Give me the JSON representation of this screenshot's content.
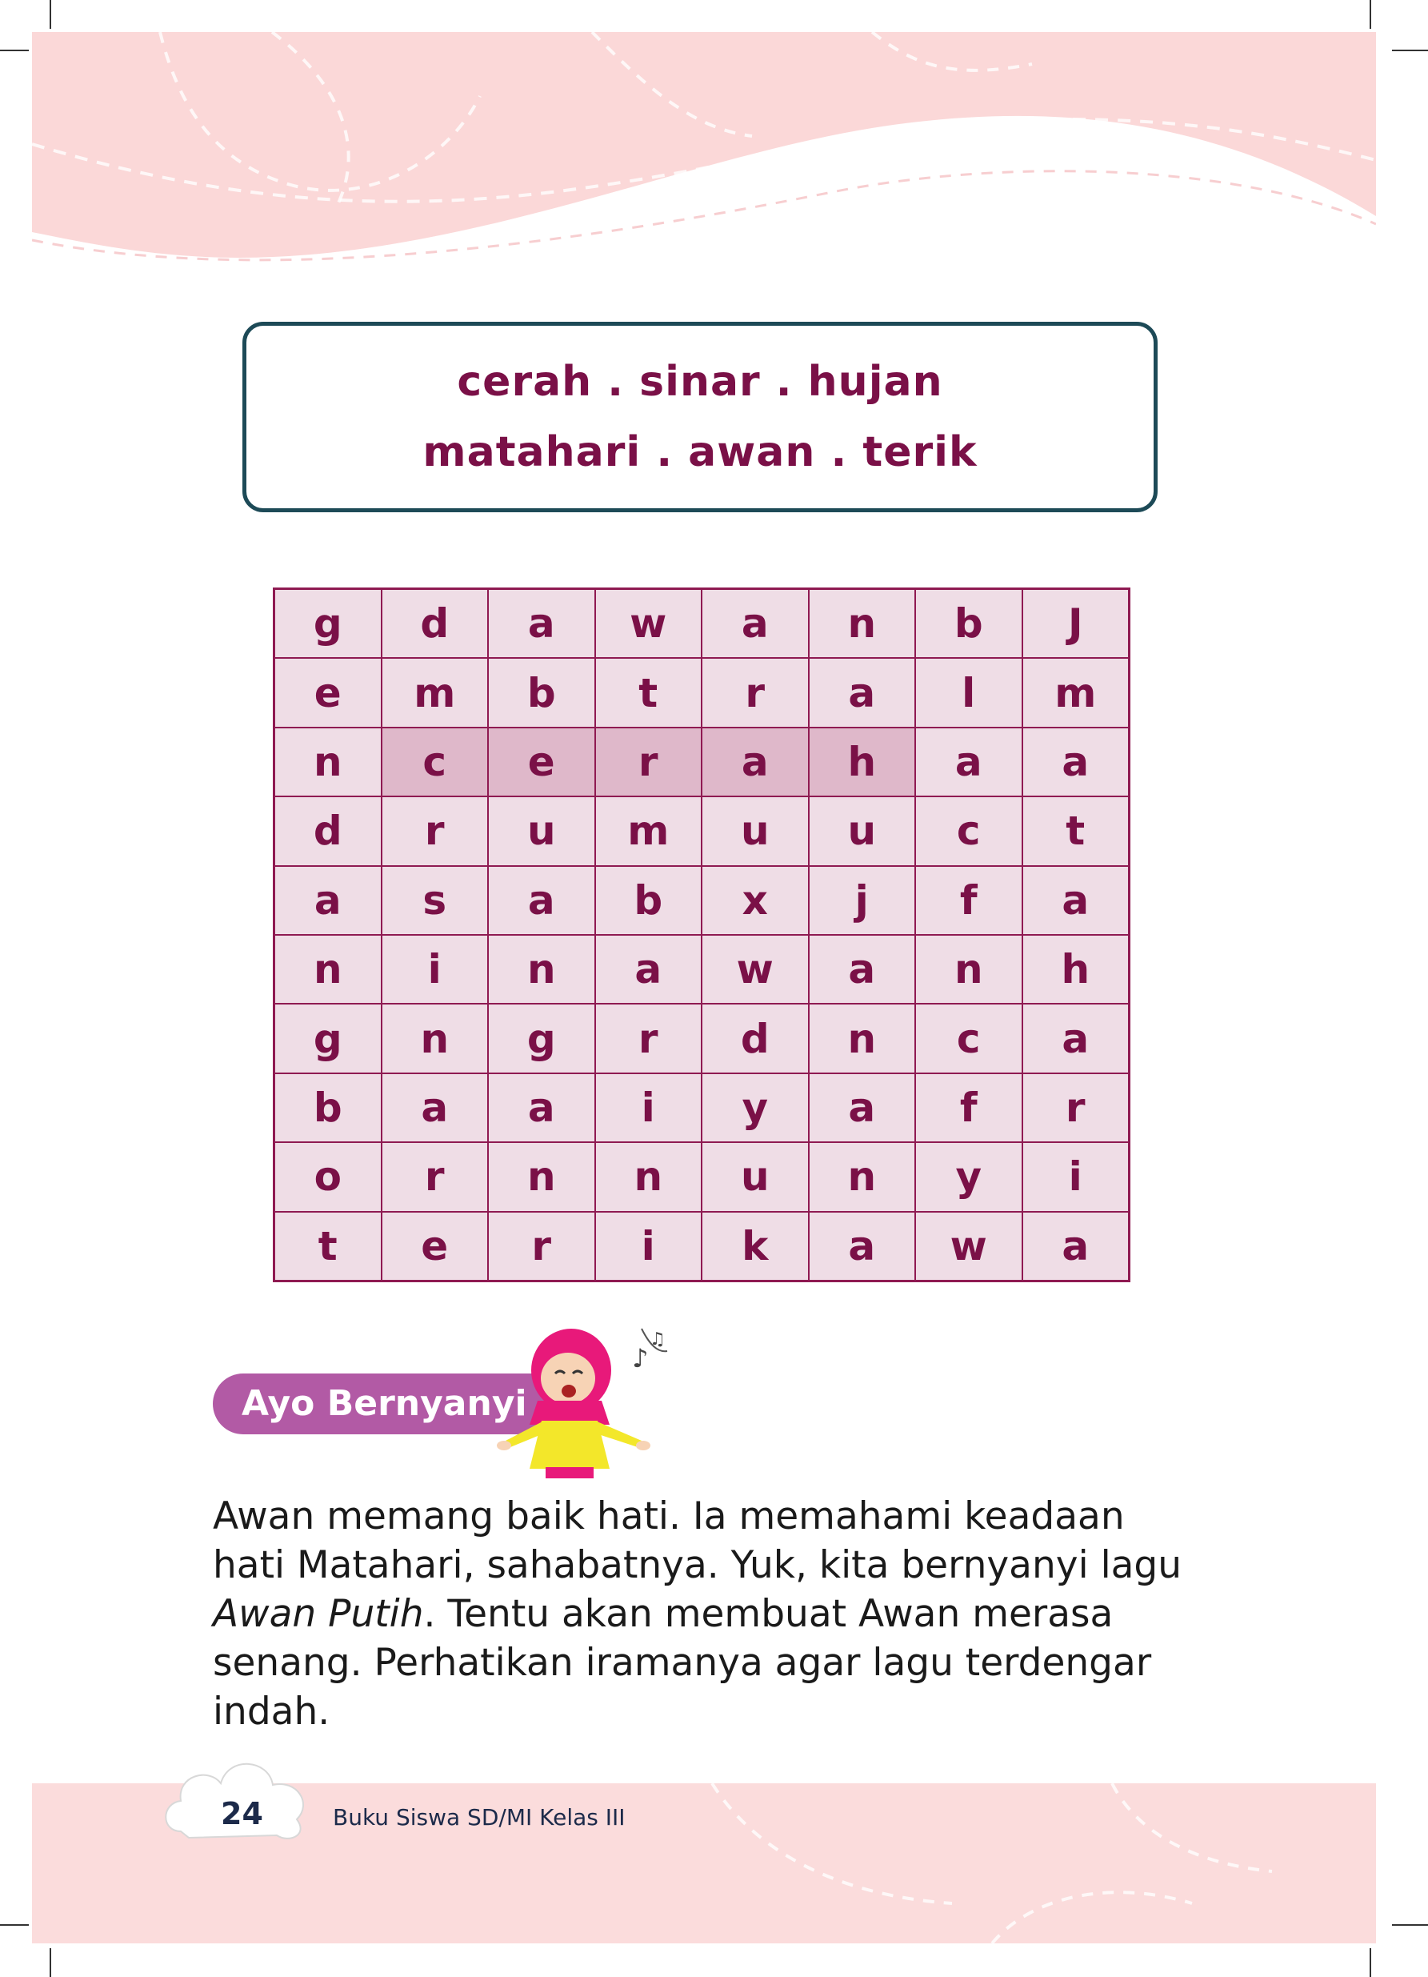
{
  "word_list": {
    "line1": "cerah . sinar . hujan",
    "line2": "matahari . awan . terik"
  },
  "puzzle": {
    "rows": [
      [
        "g",
        "d",
        "a",
        "w",
        "a",
        "n",
        "b",
        "J"
      ],
      [
        "e",
        "m",
        "b",
        "t",
        "r",
        "a",
        "l",
        "m"
      ],
      [
        "n",
        "c",
        "e",
        "r",
        "a",
        "h",
        "a",
        "a"
      ],
      [
        "d",
        "r",
        "u",
        "m",
        "u",
        "u",
        "c",
        "t"
      ],
      [
        "a",
        "s",
        "a",
        "b",
        "x",
        "j",
        "f",
        "a"
      ],
      [
        "n",
        "i",
        "n",
        "a",
        "w",
        "a",
        "n",
        "h"
      ],
      [
        "g",
        "n",
        "g",
        "r",
        "d",
        "n",
        "c",
        "a"
      ],
      [
        "b",
        "a",
        "a",
        "i",
        "y",
        "a",
        "f",
        "r"
      ],
      [
        "o",
        "r",
        "n",
        "n",
        "u",
        "n",
        "y",
        "i"
      ],
      [
        "t",
        "e",
        "r",
        "i",
        "k",
        "a",
        "w",
        "a"
      ]
    ],
    "highlighted_word": "cerah"
  },
  "section": {
    "title": "Ayo Bernyanyi"
  },
  "paragraph": {
    "part1": "Awan memang baik hati. Ia memahami keadaan hati Matahari, sahabatnya. Yuk, kita bernyanyi lagu ",
    "song_title": "Awan Putih",
    "part2": ". Tentu akan membuat Awan merasa senang. Perhatikan iramanya agar lagu terdengar indah."
  },
  "footer": {
    "page_number": "24",
    "book_title": "Buku Siswa SD/MI Kelas III"
  },
  "colors": {
    "accent": "#7a1047",
    "box_border": "#1d4a57",
    "tab": "#b25aa5",
    "band": "#fbdcdc"
  }
}
